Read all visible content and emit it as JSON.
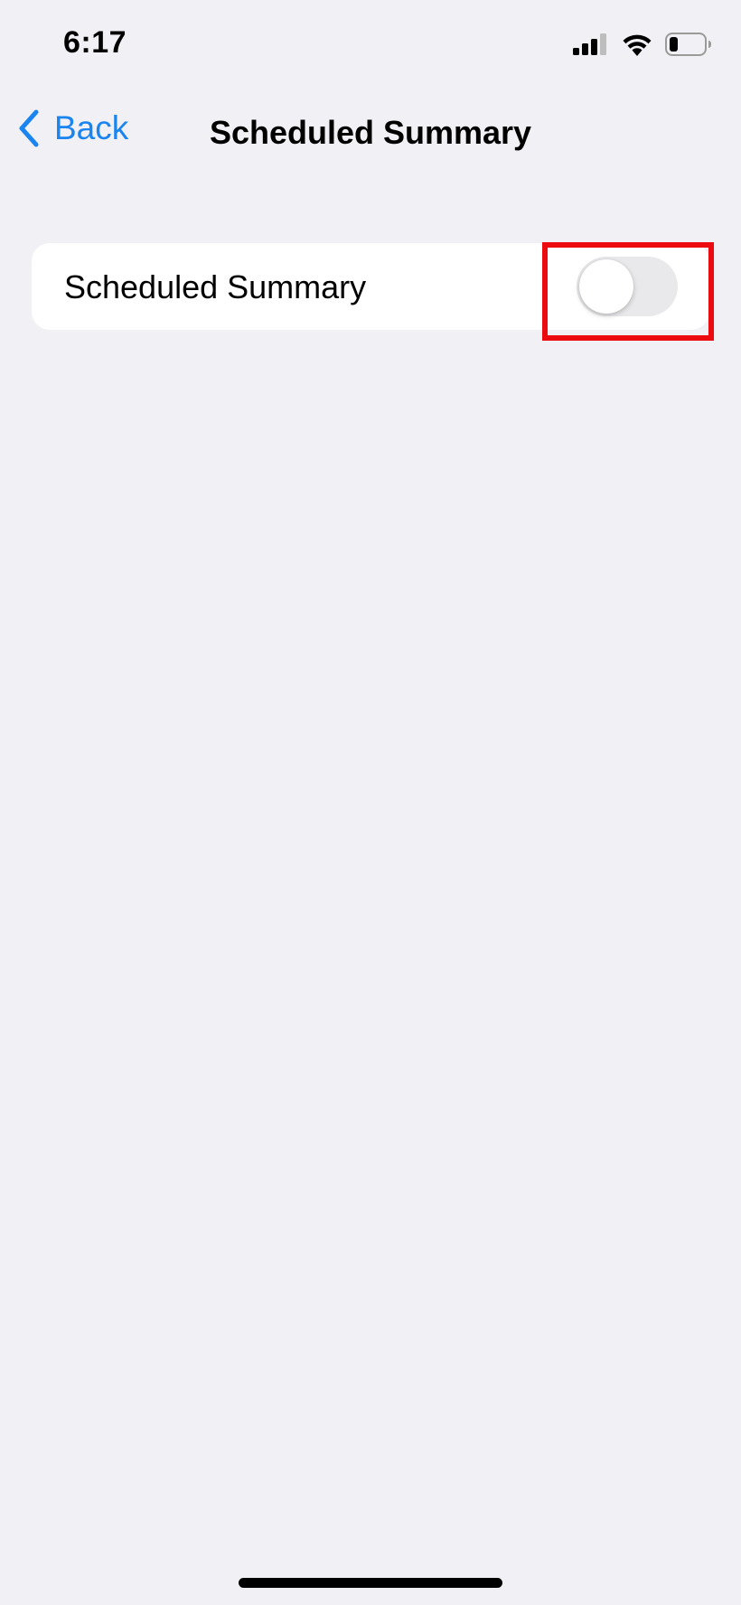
{
  "status_bar": {
    "time": "6:17",
    "icons": [
      "cellular-signal-icon",
      "wifi-icon",
      "battery-icon"
    ],
    "battery_level": 0.25
  },
  "nav": {
    "back_label": "Back",
    "title": "Scheduled Summary"
  },
  "settings": {
    "rows": [
      {
        "label": "Scheduled Summary",
        "toggle_on": false
      }
    ]
  },
  "colors": {
    "accent": "#1a84f0",
    "background": "#f0f0f5",
    "highlight": "#ec0c10",
    "toggle_off": "#e9e9eb"
  }
}
